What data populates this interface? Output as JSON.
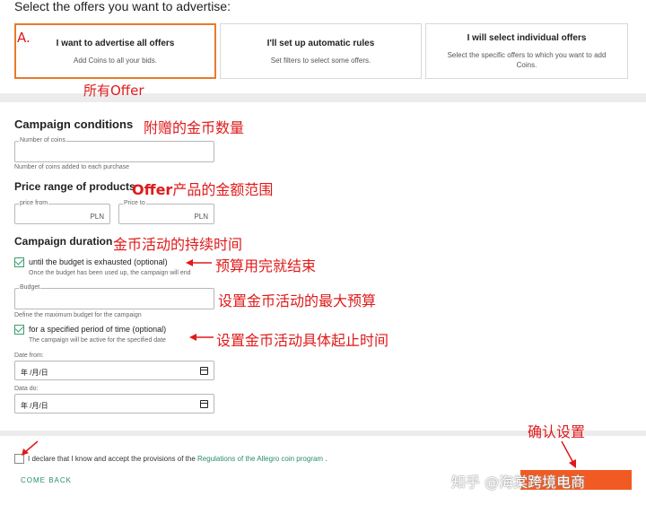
{
  "header": {
    "title": "Select the offers you want to advertise:"
  },
  "offers": [
    {
      "title": "I want to advertise all offers",
      "desc": "Add Coins to all your bids."
    },
    {
      "title": "I'll set up automatic rules",
      "desc": "Set filters to select some offers."
    },
    {
      "title": "I will select individual offers",
      "desc": "Select the specific offers to which you want to add Coins."
    }
  ],
  "campaign": {
    "title": "Campaign conditions",
    "coins_label": "Number of coins",
    "coins_hint": "Number of coins added to each purchase",
    "price_title": "Price range of products",
    "price_from_label": "price from",
    "price_to_label": "Price to",
    "currency": "PLN",
    "duration_title": "Campaign duration",
    "budget_option": "until the budget is exhausted (optional)",
    "budget_option_hint": "Once the budget has been used up, the campaign will end",
    "budget_label": "Budget",
    "budget_hint": "Define the maximum budget for the campaign",
    "period_option": "for a specified period of time (optional)",
    "period_option_hint": "The campaign will be active for the specified date",
    "date_from_label": "Date from:",
    "date_from_value": "年 /月/日",
    "date_to_label": "Data do:",
    "date_to_value": "年 /月/日"
  },
  "footer": {
    "declare_text": "I declare that I know and accept the provisions of the",
    "declare_link": "Regulations of the Allegro coin program",
    "declare_end": ".",
    "come_back": "COME BACK",
    "link_color": "#2a8c6c"
  },
  "annotations": {
    "a": "A.",
    "all_offers": "所有Offer",
    "coins": "附赠的金币数量",
    "price_offer": "Offer",
    "price_rest": "产品的金额范围",
    "duration": "金币活动的持续时间",
    "budget_end": "预算用完就结束",
    "max_budget": "设置金币活动的最大预算",
    "period": "设置金币活动具体起止时间",
    "confirm": "确认设置",
    "color": "#e0191a"
  },
  "watermark": {
    "text": "知乎 @海棠跨境电商"
  }
}
